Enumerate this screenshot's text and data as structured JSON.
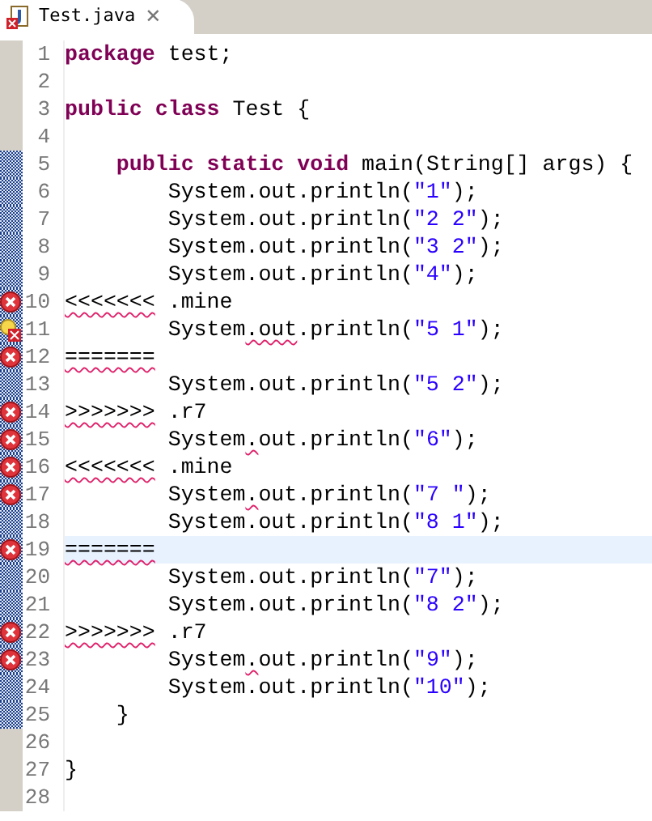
{
  "tab": {
    "title": "Test.java",
    "selected": true,
    "has_error": true,
    "close": "✕"
  },
  "lines": [
    {
      "number": "1",
      "changed": false,
      "segments": [
        {
          "kind": "keyword",
          "text": "package"
        },
        {
          "kind": "plain",
          "text": " test;"
        }
      ]
    },
    {
      "number": "2",
      "changed": false
    },
    {
      "number": "3",
      "changed": false,
      "segments": [
        {
          "kind": "keyword",
          "text": "public class"
        },
        {
          "kind": "plain",
          "text": " Test {"
        }
      ]
    },
    {
      "number": "4",
      "changed": false
    },
    {
      "number": "5",
      "changed": true,
      "segments": [
        {
          "kind": "keyword",
          "text": "    public static void"
        },
        {
          "kind": "plain",
          "text": " main(String[] args) {"
        }
      ]
    },
    {
      "number": "6",
      "changed": true,
      "segments": [
        {
          "kind": "plain",
          "text": "        System.out.println("
        },
        {
          "kind": "string",
          "text": "\"1\""
        },
        {
          "kind": "plain",
          "text": ");"
        }
      ]
    },
    {
      "number": "7",
      "changed": true,
      "segments": [
        {
          "kind": "plain",
          "text": "        System.out.println("
        },
        {
          "kind": "string",
          "text": "\"2 2\""
        },
        {
          "kind": "plain",
          "text": ");"
        }
      ]
    },
    {
      "number": "8",
      "changed": true,
      "segments": [
        {
          "kind": "plain",
          "text": "        System.out.println("
        },
        {
          "kind": "string",
          "text": "\"3 2\""
        },
        {
          "kind": "plain",
          "text": ");"
        }
      ]
    },
    {
      "number": "9",
      "changed": true,
      "segments": [
        {
          "kind": "plain",
          "text": "        System.out.println("
        },
        {
          "kind": "string",
          "text": "\"4\""
        },
        {
          "kind": "plain",
          "text": ");"
        }
      ]
    },
    {
      "number": "10",
      "changed": true,
      "has_error": true,
      "segments": [
        {
          "kind": "plain",
          "text": "<<<<<<<",
          "error": true
        },
        {
          "kind": "plain",
          "text": " .mine"
        }
      ]
    },
    {
      "number": "11",
      "changed": true,
      "has_error": true,
      "has_quickfix": true,
      "segments": [
        {
          "kind": "plain",
          "text": "        System"
        },
        {
          "kind": "plain",
          "text": ".out",
          "error": true
        },
        {
          "kind": "plain",
          "text": ".println("
        },
        {
          "kind": "string",
          "text": "\"5 1\""
        },
        {
          "kind": "plain",
          "text": ");"
        }
      ]
    },
    {
      "number": "12",
      "changed": true,
      "has_error": true,
      "segments": [
        {
          "kind": "plain",
          "text": "=======",
          "error": true
        }
      ]
    },
    {
      "number": "13",
      "changed": true,
      "segments": [
        {
          "kind": "plain",
          "text": "        System.out.println("
        },
        {
          "kind": "string",
          "text": "\"5 2\""
        },
        {
          "kind": "plain",
          "text": ");"
        }
      ]
    },
    {
      "number": "14",
      "changed": true,
      "has_error": true,
      "segments": [
        {
          "kind": "plain",
          "text": ">>>>>>>",
          "error": true
        },
        {
          "kind": "plain",
          "text": " .r7"
        }
      ]
    },
    {
      "number": "15",
      "changed": true,
      "has_error": true,
      "segments": [
        {
          "kind": "plain",
          "text": "        System"
        },
        {
          "kind": "plain",
          "text": ".",
          "error": true
        },
        {
          "kind": "plain",
          "text": "out.println("
        },
        {
          "kind": "string",
          "text": "\"6\""
        },
        {
          "kind": "plain",
          "text": ");"
        }
      ]
    },
    {
      "number": "16",
      "changed": true,
      "has_error": true,
      "segments": [
        {
          "kind": "plain",
          "text": "<<<<<<<",
          "error": true
        },
        {
          "kind": "plain",
          "text": " .mine"
        }
      ]
    },
    {
      "number": "17",
      "changed": true,
      "has_error": true,
      "segments": [
        {
          "kind": "plain",
          "text": "        System"
        },
        {
          "kind": "plain",
          "text": ".",
          "error": true
        },
        {
          "kind": "plain",
          "text": "out.println("
        },
        {
          "kind": "string",
          "text": "\"7 \""
        },
        {
          "kind": "plain",
          "text": ");"
        }
      ]
    },
    {
      "number": "18",
      "changed": true,
      "segments": [
        {
          "kind": "plain",
          "text": "        System.out.println("
        },
        {
          "kind": "string",
          "text": "\"8 1\""
        },
        {
          "kind": "plain",
          "text": ");"
        }
      ]
    },
    {
      "number": "19",
      "changed": true,
      "current": true,
      "has_error": true,
      "segments": [
        {
          "kind": "plain",
          "text": "=======",
          "error": true
        }
      ]
    },
    {
      "number": "20",
      "changed": true,
      "segments": [
        {
          "kind": "plain",
          "text": "        System.out.println("
        },
        {
          "kind": "string",
          "text": "\"7\""
        },
        {
          "kind": "plain",
          "text": ");"
        }
      ]
    },
    {
      "number": "21",
      "changed": true,
      "segments": [
        {
          "kind": "plain",
          "text": "        System.out.println("
        },
        {
          "kind": "string",
          "text": "\"8 2\""
        },
        {
          "kind": "plain",
          "text": ");"
        }
      ]
    },
    {
      "number": "22",
      "changed": true,
      "has_error": true,
      "segments": [
        {
          "kind": "plain",
          "text": ">>>>>>>",
          "error": true
        },
        {
          "kind": "plain",
          "text": " .r7"
        }
      ]
    },
    {
      "number": "23",
      "changed": true,
      "has_error": true,
      "segments": [
        {
          "kind": "plain",
          "text": "        System"
        },
        {
          "kind": "plain",
          "text": ".",
          "error": true
        },
        {
          "kind": "plain",
          "text": "out.println("
        },
        {
          "kind": "string",
          "text": "\"9\""
        },
        {
          "kind": "plain",
          "text": ");"
        }
      ]
    },
    {
      "number": "24",
      "changed": true,
      "segments": [
        {
          "kind": "plain",
          "text": "        System.out.println("
        },
        {
          "kind": "string",
          "text": "\"10\""
        },
        {
          "kind": "plain",
          "text": ");"
        }
      ]
    },
    {
      "number": "25",
      "changed": true,
      "segments": [
        {
          "kind": "plain",
          "text": "    }"
        }
      ]
    },
    {
      "number": "26",
      "changed": false
    },
    {
      "number": "27",
      "changed": false,
      "segments": [
        {
          "kind": "plain",
          "text": "}"
        }
      ]
    },
    {
      "number": "28",
      "changed": false
    }
  ]
}
